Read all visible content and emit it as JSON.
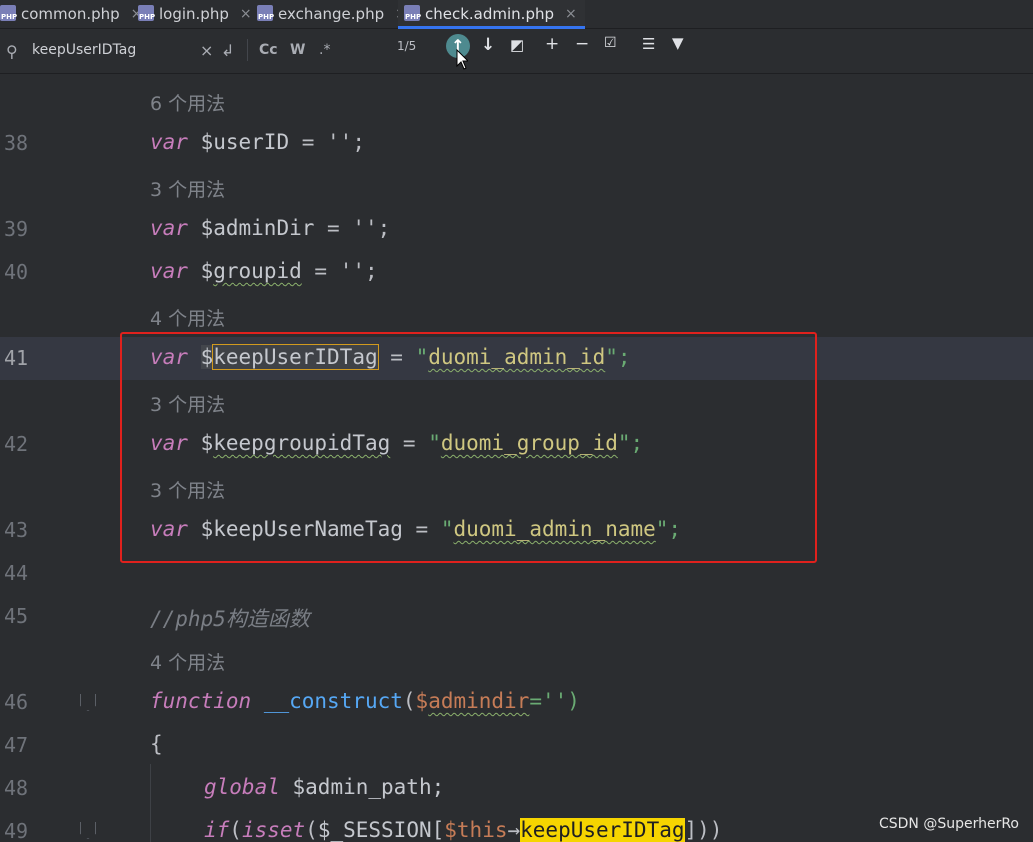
{
  "tabs": [
    {
      "label": "common.php",
      "icon": "php-file-icon",
      "active": false
    },
    {
      "label": "login.php",
      "icon": "php-file-icon",
      "active": false
    },
    {
      "label": "exchange.php",
      "icon": "php-file-icon",
      "active": false
    },
    {
      "label": "check.admin.php",
      "icon": "php-file-icon",
      "active": true
    }
  ],
  "file_icon_text": "PHP",
  "close_glyph": "×",
  "search": {
    "query": "keepUserIDTag",
    "clear_glyph": "×",
    "match_case": "Cc",
    "words": "W",
    "regex": ".*",
    "result_count": "1/5"
  },
  "editor": {
    "usages": {
      "u1": "6 个用法",
      "u2": "3 个用法",
      "u3": "4 个用法",
      "u4": "3 个用法",
      "u5": "3 个用法",
      "u6": "4 个用法"
    },
    "line_numbers": {
      "l38": "38",
      "l39": "39",
      "l40": "40",
      "l41": "41",
      "l42": "42",
      "l43": "43",
      "l44": "44",
      "l45": "45",
      "l46": "46",
      "l47": "47",
      "l48": "48",
      "l49": "49"
    },
    "tokens": {
      "var": "var",
      "function": "function",
      "global": "global",
      "if": "if",
      "isset": "isset",
      "userID": "$userID",
      "adminDir": "$adminDir",
      "groupid_dollar": "$",
      "groupid": "groupid",
      "dollar": "$",
      "keepUserIDTag": "keepUserIDTag",
      "keepgroupidTag_dollar": "$",
      "keepgroupidTag": "keepgroupidTag",
      "keepUserNameTag": "$keepUserNameTag",
      "assign_empty": " = '';",
      "assign": " = ",
      "quote": "\"",
      "quote_end": "\";",
      "admin_id": "duomi_admin_id",
      "group_id": "duomi_group_id",
      "admin_name": "duomi_admin_name",
      "comment": "//php5构造函数",
      "construct": "__construct",
      "paren_open": "(",
      "admindir_dollar": "$",
      "admindir": "admindir",
      "default_empty": "='')",
      "brace": "{",
      "admin_path": "$admin_path;",
      "session": "$_SESSION[",
      "this": "$this",
      "arrow": "→",
      "close": "]))"
    }
  },
  "watermark": "CSDN @SuperherRo",
  "colors": {
    "background": "#2b2d30",
    "keyword": "#c77dbb",
    "string": "#6aab73",
    "function": "#56a8f5",
    "highlight_box": "#e0211d",
    "search_match": "#f6d500"
  }
}
